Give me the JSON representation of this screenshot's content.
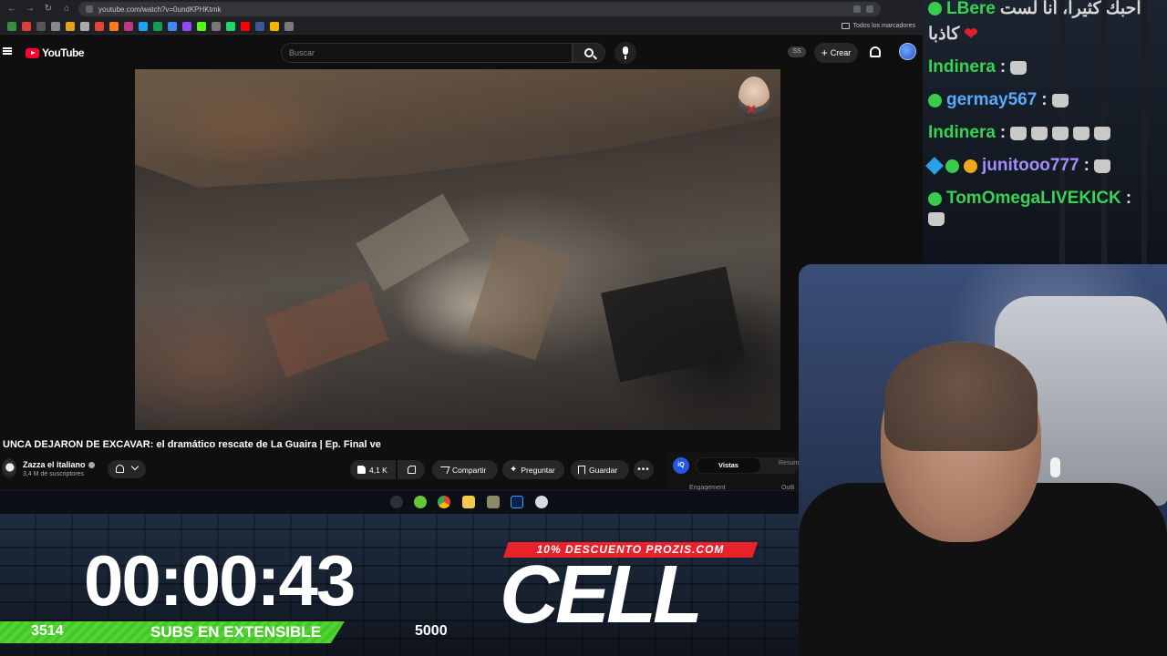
{
  "browser": {
    "url": "youtube.com/watch?v=0undKPHKtmk",
    "bookmarks_folder": "Todos los marcadores"
  },
  "youtube": {
    "logo_text": "YouTube",
    "search_placeholder": "Buscar",
    "badge": "SS",
    "create_label": "Crear",
    "video": {
      "title": "UNCA DEJARON DE EXCAVAR: el dramático rescate de La Guaira | Ep. Final ve",
      "channel_name": "Zazza el italiano",
      "subscribers": "3,4 M de suscriptores",
      "likes": "4,1 K",
      "share_label": "Compartir",
      "ask_label": "Preguntar",
      "save_label": "Guardar"
    },
    "vidiq": {
      "logo": "iQ",
      "tab_active": "Vistas",
      "tab_2": "Resum",
      "engagement": "Engagement",
      "outliers": "Outli"
    }
  },
  "chat": {
    "messages": [
      {
        "user": "LBere",
        "text": "احبك كثيرا، أنا لست",
        "text2": "كاذبا"
      },
      {
        "user": "Indinera",
        "text": ":"
      },
      {
        "user": "germay567",
        "text": ":"
      },
      {
        "user": "Indinera",
        "text": ":"
      },
      {
        "user": "junitooo777",
        "text": ":"
      },
      {
        "user": "TomOmegaLIVEKICK",
        "text": ":"
      }
    ]
  },
  "overlay": {
    "timer": "00:00:43",
    "subs_current": "3514",
    "subs_label": "SUBS EN EXTENSIBLE",
    "subs_goal": "5000",
    "promo": "10% DESCUENTO PROZIS.COM",
    "brand": "CELL"
  },
  "colors": {
    "youtube_red": "#ff0033",
    "subs_bar_green": "#4fd630",
    "promo_red": "#e8222a"
  },
  "icons": [
    "menu-icon",
    "search-icon",
    "mic-icon",
    "bell-icon",
    "verified-icon",
    "like-icon",
    "dislike-icon",
    "share-icon",
    "sparkle-icon",
    "bookmark-icon",
    "more-icon",
    "heart-icon",
    "emote-icon"
  ]
}
